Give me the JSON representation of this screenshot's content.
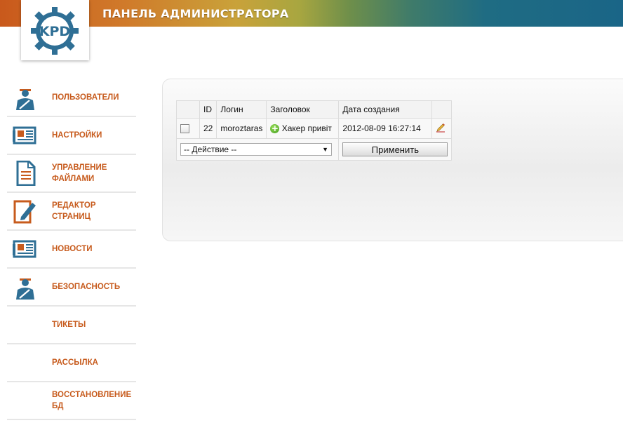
{
  "header": {
    "title": "ПАНЕЛЬ АДМИНИСТРАТОРА"
  },
  "logo": {
    "text": "KPD",
    "icon": "gear-logo-icon"
  },
  "colors": {
    "accent": "#c75b1d",
    "icon_blue": "#2f6f95",
    "icon_orange": "#c75b1d"
  },
  "sidebar": {
    "items": [
      {
        "label1": "ПОЛЬЗОВАТЕЛИ",
        "label2": "",
        "icon": "user-icon"
      },
      {
        "label1": "НАСТРОЙКИ",
        "label2": "",
        "icon": "newspaper-icon"
      },
      {
        "label1": "УПРАВЛЕНИЕ",
        "label2": "ФАЙЛАМИ",
        "icon": "document-icon"
      },
      {
        "label1": "РЕДАКТОР",
        "label2": "СТРАНИЦ",
        "icon": "edit-page-icon"
      },
      {
        "label1": "НОВОСТИ",
        "label2": "",
        "icon": "newspaper-icon"
      },
      {
        "label1": "БЕЗОПАСНОСТЬ",
        "label2": "",
        "icon": "user-icon"
      },
      {
        "label1": "ТИКЕТЫ",
        "label2": "",
        "icon": ""
      },
      {
        "label1": "РАССЫЛКА",
        "label2": "",
        "icon": ""
      },
      {
        "label1": "ВОССТАНОВЛЕНИЕ",
        "label2": "БД",
        "icon": ""
      }
    ]
  },
  "table": {
    "headers": [
      "",
      "ID",
      "Логин",
      "Заголовок",
      "Дата создания",
      ""
    ],
    "rows": [
      {
        "id": "22",
        "login": "moroztaras",
        "title": "Хакер привіт",
        "date": "2012-08-09 16:27:14"
      }
    ],
    "action_select": "-- Действие --",
    "apply_button": "Применить"
  }
}
